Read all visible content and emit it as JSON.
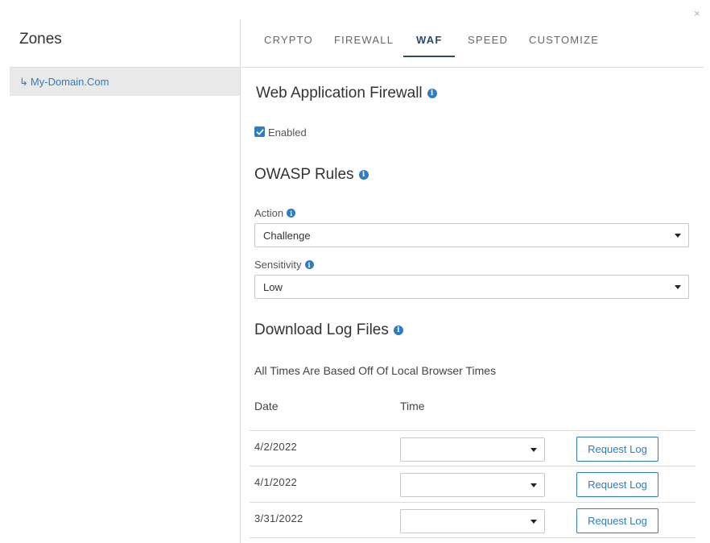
{
  "dialog": {
    "close_glyph": "×"
  },
  "sidebar": {
    "title": "Zones",
    "zone": {
      "arrow": "↳",
      "label": "My-Domain.Com"
    }
  },
  "tabs": [
    {
      "label": "CRYPTO",
      "active": false
    },
    {
      "label": "FIREWALL",
      "active": false
    },
    {
      "label": "WAF",
      "active": true
    },
    {
      "label": "SPEED",
      "active": false
    },
    {
      "label": "CUSTOMIZE",
      "active": false
    }
  ],
  "waf": {
    "title": "Web Application Firewall",
    "enabled_label": "Enabled",
    "enabled": true
  },
  "owasp": {
    "title": "OWASP Rules",
    "action_label": "Action",
    "action_value": "Challenge",
    "sensitivity_label": "Sensitivity",
    "sensitivity_value": "Low"
  },
  "logs": {
    "title": "Download Log Files",
    "note": "All Times Are Based Off Of Local Browser Times",
    "col_date": "Date",
    "col_time": "Time",
    "rows": [
      {
        "date": "4/2/2022",
        "time": "",
        "button": "Request Log"
      },
      {
        "date": "4/1/2022",
        "time": "",
        "button": "Request Log"
      },
      {
        "date": "3/31/2022",
        "time": "",
        "button": "Request Log"
      }
    ]
  },
  "colors": {
    "accent": "#2d7cc4",
    "tab_active": "#2b4a6e",
    "selected_bg": "#e9e9e9"
  },
  "icons": {
    "info": "info-icon",
    "check": "check-icon",
    "caret": "chevron-down-icon",
    "close": "close-icon"
  }
}
